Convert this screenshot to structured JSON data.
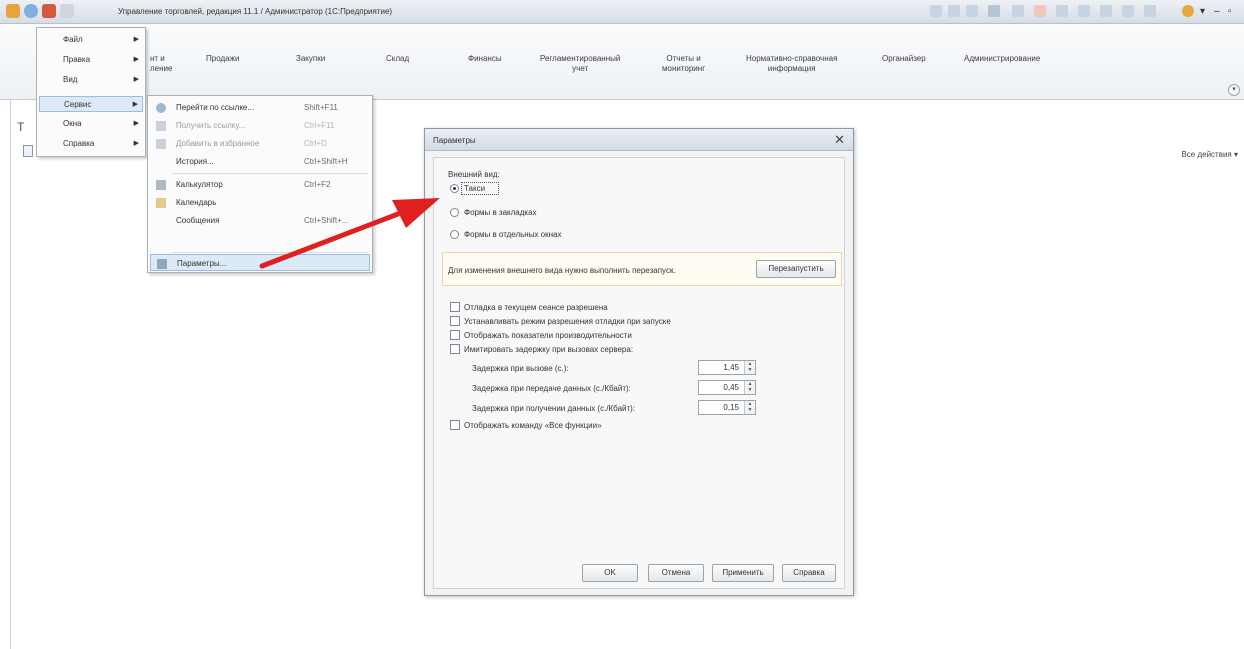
{
  "window": {
    "title": "Управление торговлей, редакция 11.1 / Администратор  (1С:Предприятие)",
    "controls": [
      "▾",
      "–",
      "▫"
    ]
  },
  "sections": [
    {
      "label": "нт и\nление"
    },
    {
      "label": "Продажи"
    },
    {
      "label": "Закупки"
    },
    {
      "label": "Склад"
    },
    {
      "label": "Финансы"
    },
    {
      "label": "Регламентированный\nучет"
    },
    {
      "label": "Отчеты и\nмониторинг"
    },
    {
      "label": "Нормативно-справочная\nинформация"
    },
    {
      "label": "Органайзер"
    },
    {
      "label": "Администрирование"
    }
  ],
  "side": {
    "letter": "Т",
    "all_actions": "Все действия ▾"
  },
  "main_menu": [
    {
      "label": "Файл"
    },
    {
      "label": "Правка"
    },
    {
      "label": "Вид"
    },
    {
      "label": "Сервис"
    },
    {
      "label": "Окна"
    },
    {
      "label": "Справка"
    }
  ],
  "service_menu": [
    {
      "label": "Перейти по ссылке...",
      "shortcut": "Shift+F11",
      "icon": "link-icon"
    },
    {
      "label": "Получить ссылку...",
      "shortcut": "Ctrl+F11",
      "icon": "get-link-icon"
    },
    {
      "label": "Добавить в избранное",
      "shortcut": "Ctrl+D",
      "icon": "favorite-icon"
    },
    {
      "label": "История...",
      "shortcut": "Ctrl+Shift+H",
      "icon": ""
    },
    {
      "label": "Калькулятор",
      "shortcut": "Ctrl+F2",
      "icon": "calculator-icon"
    },
    {
      "label": "Календарь",
      "shortcut": "",
      "icon": "calendar-icon"
    },
    {
      "label": "Сообщения",
      "shortcut": "Ctrl+Shift+...",
      "icon": ""
    },
    {
      "label": "Параметры...",
      "shortcut": "",
      "icon": "parameters-icon"
    }
  ],
  "dialog": {
    "title": "Параметры",
    "appearance_label": "Внешний вид:",
    "radios": [
      {
        "label": "Такси",
        "checked": true
      },
      {
        "label": "Формы в закладках",
        "checked": false
      },
      {
        "label": "Формы в отдельных окнах",
        "checked": false
      }
    ],
    "restart_note": "Для изменения внешнего вида нужно выполнить перезапуск.",
    "restart_button": "Перезапустить",
    "checkboxes": [
      {
        "label": "Отладка в текущем сеансе разрешена",
        "checked": false
      },
      {
        "label": "Устанавливать режим разрешения отладки при запуске",
        "checked": false
      },
      {
        "label": "Отображать показатели производительности",
        "checked": false
      },
      {
        "label": "Имитировать задержку при вызовах сервера:",
        "checked": false
      }
    ],
    "delays": [
      {
        "label": "Задержка при вызове (с.):",
        "value": "1,45"
      },
      {
        "label": "Задержка при передаче данных (с./Кбайт):",
        "value": "0,45"
      },
      {
        "label": "Задержка при получении данных (с./Кбайт):",
        "value": "0,15"
      }
    ],
    "all_functions_checkbox": {
      "label": "Отображать команду «Все функции»",
      "checked": false
    },
    "buttons": {
      "ok": "OK",
      "cancel": "Отмена",
      "apply": "Применить",
      "help": "Справка"
    }
  },
  "colors": {
    "accent_arrow": "#e02020",
    "selection": "#dce9f7"
  }
}
